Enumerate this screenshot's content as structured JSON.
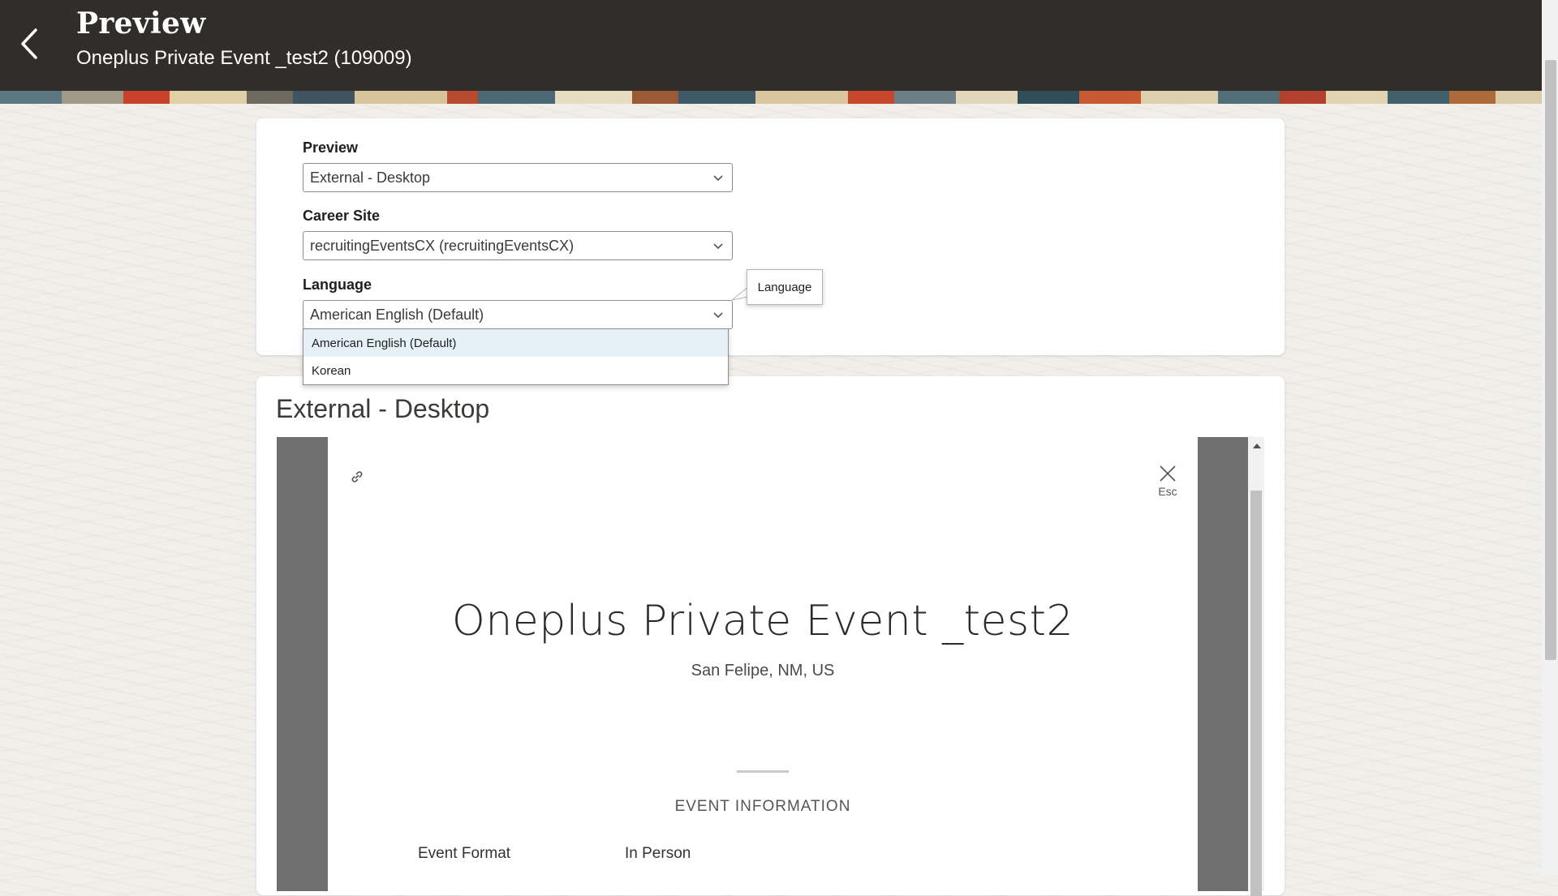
{
  "header": {
    "title": "Preview",
    "subtitle": "Oneplus Private Event _test2 (109009)"
  },
  "settings": {
    "preview": {
      "label": "Preview",
      "value": "External - Desktop"
    },
    "career_site": {
      "label": "Career Site",
      "value": "recruitingEventsCX (recruitingEventsCX)"
    },
    "language": {
      "label": "Language",
      "value": "American English (Default)",
      "options": [
        "American English (Default)",
        "Korean"
      ],
      "tooltip": "Language"
    }
  },
  "preview_panel": {
    "title": "External - Desktop",
    "close_hint": "Esc",
    "event": {
      "title": "Oneplus Private Event _test2",
      "location": "San Felipe, NM, US",
      "section_heading": "EVENT INFORMATION",
      "format_label": "Event Format",
      "format_value": "In Person"
    }
  },
  "icons": [
    "back-arrow-icon",
    "chevron-down-icon",
    "link-icon",
    "close-icon"
  ]
}
